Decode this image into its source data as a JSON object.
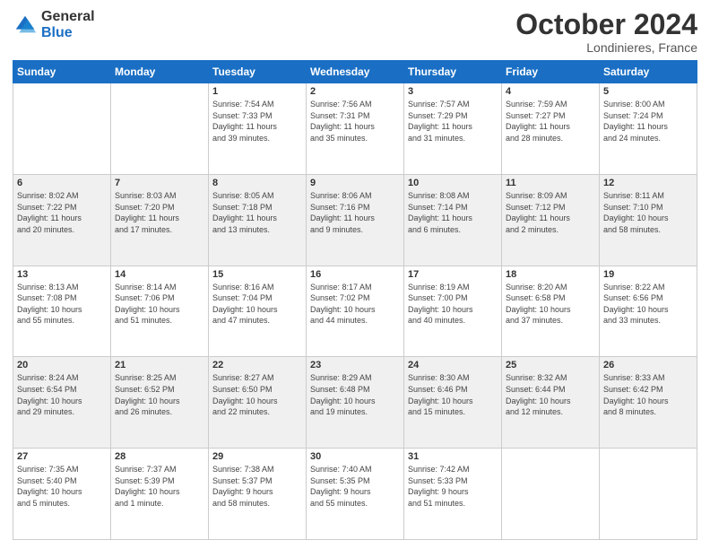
{
  "header": {
    "logo_line1": "General",
    "logo_line2": "Blue",
    "month": "October 2024",
    "location": "Londinieres, France"
  },
  "days_of_week": [
    "Sunday",
    "Monday",
    "Tuesday",
    "Wednesday",
    "Thursday",
    "Friday",
    "Saturday"
  ],
  "weeks": [
    [
      {
        "day": "",
        "detail": ""
      },
      {
        "day": "",
        "detail": ""
      },
      {
        "day": "1",
        "detail": "Sunrise: 7:54 AM\nSunset: 7:33 PM\nDaylight: 11 hours\nand 39 minutes."
      },
      {
        "day": "2",
        "detail": "Sunrise: 7:56 AM\nSunset: 7:31 PM\nDaylight: 11 hours\nand 35 minutes."
      },
      {
        "day": "3",
        "detail": "Sunrise: 7:57 AM\nSunset: 7:29 PM\nDaylight: 11 hours\nand 31 minutes."
      },
      {
        "day": "4",
        "detail": "Sunrise: 7:59 AM\nSunset: 7:27 PM\nDaylight: 11 hours\nand 28 minutes."
      },
      {
        "day": "5",
        "detail": "Sunrise: 8:00 AM\nSunset: 7:24 PM\nDaylight: 11 hours\nand 24 minutes."
      }
    ],
    [
      {
        "day": "6",
        "detail": "Sunrise: 8:02 AM\nSunset: 7:22 PM\nDaylight: 11 hours\nand 20 minutes."
      },
      {
        "day": "7",
        "detail": "Sunrise: 8:03 AM\nSunset: 7:20 PM\nDaylight: 11 hours\nand 17 minutes."
      },
      {
        "day": "8",
        "detail": "Sunrise: 8:05 AM\nSunset: 7:18 PM\nDaylight: 11 hours\nand 13 minutes."
      },
      {
        "day": "9",
        "detail": "Sunrise: 8:06 AM\nSunset: 7:16 PM\nDaylight: 11 hours\nand 9 minutes."
      },
      {
        "day": "10",
        "detail": "Sunrise: 8:08 AM\nSunset: 7:14 PM\nDaylight: 11 hours\nand 6 minutes."
      },
      {
        "day": "11",
        "detail": "Sunrise: 8:09 AM\nSunset: 7:12 PM\nDaylight: 11 hours\nand 2 minutes."
      },
      {
        "day": "12",
        "detail": "Sunrise: 8:11 AM\nSunset: 7:10 PM\nDaylight: 10 hours\nand 58 minutes."
      }
    ],
    [
      {
        "day": "13",
        "detail": "Sunrise: 8:13 AM\nSunset: 7:08 PM\nDaylight: 10 hours\nand 55 minutes."
      },
      {
        "day": "14",
        "detail": "Sunrise: 8:14 AM\nSunset: 7:06 PM\nDaylight: 10 hours\nand 51 minutes."
      },
      {
        "day": "15",
        "detail": "Sunrise: 8:16 AM\nSunset: 7:04 PM\nDaylight: 10 hours\nand 47 minutes."
      },
      {
        "day": "16",
        "detail": "Sunrise: 8:17 AM\nSunset: 7:02 PM\nDaylight: 10 hours\nand 44 minutes."
      },
      {
        "day": "17",
        "detail": "Sunrise: 8:19 AM\nSunset: 7:00 PM\nDaylight: 10 hours\nand 40 minutes."
      },
      {
        "day": "18",
        "detail": "Sunrise: 8:20 AM\nSunset: 6:58 PM\nDaylight: 10 hours\nand 37 minutes."
      },
      {
        "day": "19",
        "detail": "Sunrise: 8:22 AM\nSunset: 6:56 PM\nDaylight: 10 hours\nand 33 minutes."
      }
    ],
    [
      {
        "day": "20",
        "detail": "Sunrise: 8:24 AM\nSunset: 6:54 PM\nDaylight: 10 hours\nand 29 minutes."
      },
      {
        "day": "21",
        "detail": "Sunrise: 8:25 AM\nSunset: 6:52 PM\nDaylight: 10 hours\nand 26 minutes."
      },
      {
        "day": "22",
        "detail": "Sunrise: 8:27 AM\nSunset: 6:50 PM\nDaylight: 10 hours\nand 22 minutes."
      },
      {
        "day": "23",
        "detail": "Sunrise: 8:29 AM\nSunset: 6:48 PM\nDaylight: 10 hours\nand 19 minutes."
      },
      {
        "day": "24",
        "detail": "Sunrise: 8:30 AM\nSunset: 6:46 PM\nDaylight: 10 hours\nand 15 minutes."
      },
      {
        "day": "25",
        "detail": "Sunrise: 8:32 AM\nSunset: 6:44 PM\nDaylight: 10 hours\nand 12 minutes."
      },
      {
        "day": "26",
        "detail": "Sunrise: 8:33 AM\nSunset: 6:42 PM\nDaylight: 10 hours\nand 8 minutes."
      }
    ],
    [
      {
        "day": "27",
        "detail": "Sunrise: 7:35 AM\nSunset: 5:40 PM\nDaylight: 10 hours\nand 5 minutes."
      },
      {
        "day": "28",
        "detail": "Sunrise: 7:37 AM\nSunset: 5:39 PM\nDaylight: 10 hours\nand 1 minute."
      },
      {
        "day": "29",
        "detail": "Sunrise: 7:38 AM\nSunset: 5:37 PM\nDaylight: 9 hours\nand 58 minutes."
      },
      {
        "day": "30",
        "detail": "Sunrise: 7:40 AM\nSunset: 5:35 PM\nDaylight: 9 hours\nand 55 minutes."
      },
      {
        "day": "31",
        "detail": "Sunrise: 7:42 AM\nSunset: 5:33 PM\nDaylight: 9 hours\nand 51 minutes."
      },
      {
        "day": "",
        "detail": ""
      },
      {
        "day": "",
        "detail": ""
      }
    ]
  ]
}
